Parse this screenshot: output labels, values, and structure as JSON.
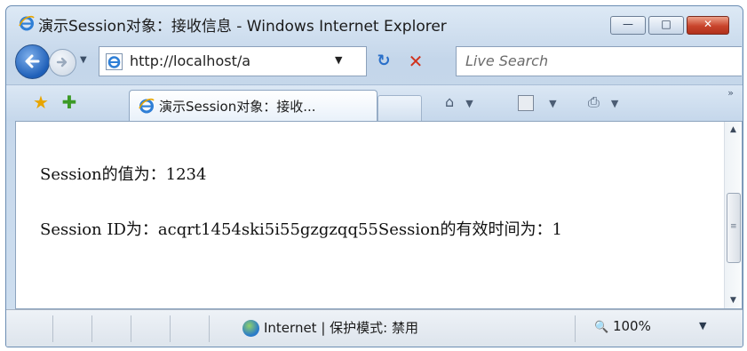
{
  "window": {
    "title": "演示Session对象：接收信息 - Windows Internet Explorer",
    "min_glyph": "—",
    "max_glyph": "□",
    "close_glyph": "✕"
  },
  "nav": {
    "address": "http://localhost/a",
    "search_placeholder": "Live Search",
    "refresh_glyph": "↻",
    "stop_glyph": "✕"
  },
  "tabs": [
    {
      "label": "演示Session对象：接收..."
    }
  ],
  "toolbar": {
    "favorites_icon": "star",
    "home_icon": "home",
    "feeds_icon": "feeds",
    "print_icon": "print",
    "dropdown_glyph": "▼",
    "more_glyph": "»"
  },
  "content": {
    "line1": "Session的值为：1234",
    "line2": "Session ID为：acqrt1454ski5i55gzgzqq55Session的有效时间为：1"
  },
  "status": {
    "zone": "Internet | 保护模式: 禁用",
    "zoom": "100%",
    "zoom_glyph": "🔍"
  },
  "colors": {
    "title_bar": "#c4d6ea",
    "close_button": "#c8442c",
    "link_blue": "#2a6fc9"
  }
}
